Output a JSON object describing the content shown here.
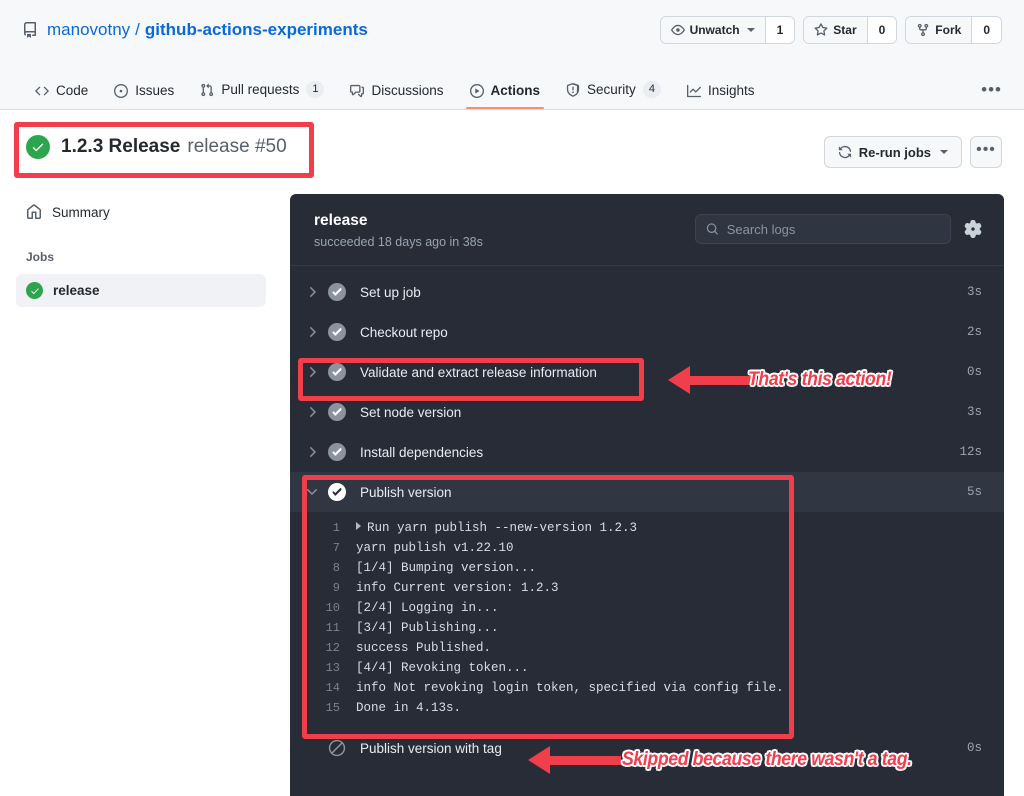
{
  "repo": {
    "owner": "manovotny",
    "separator": "/",
    "name": "github-actions-experiments",
    "repo_icon": "repo-icon"
  },
  "repo_actions": [
    {
      "label": "Unwatch",
      "count": "1",
      "icon": "eye-icon",
      "has_caret": true
    },
    {
      "label": "Star",
      "count": "0",
      "icon": "star-icon",
      "has_caret": false
    },
    {
      "label": "Fork",
      "count": "0",
      "icon": "fork-icon",
      "has_caret": false
    }
  ],
  "nav_tabs": [
    {
      "label": "Code",
      "icon": "code-icon",
      "badge": "",
      "active": false
    },
    {
      "label": "Issues",
      "icon": "issue-opened-icon",
      "badge": "",
      "active": false
    },
    {
      "label": "Pull requests",
      "icon": "git-pull-request-icon",
      "badge": "1",
      "active": false
    },
    {
      "label": "Discussions",
      "icon": "comment-discussion-icon",
      "badge": "",
      "active": false
    },
    {
      "label": "Actions",
      "icon": "play-icon",
      "badge": "",
      "active": true
    },
    {
      "label": "Security",
      "icon": "shield-icon",
      "badge": "4",
      "active": false
    },
    {
      "label": "Insights",
      "icon": "graph-icon",
      "badge": "",
      "active": false
    }
  ],
  "nav_overflow": "•••",
  "run": {
    "status_icon": "check-circle-fill-icon",
    "title": "1.2.3 Release",
    "subtitle": "release #50",
    "rerun_label": "Re-run jobs",
    "rerun_icon": "sync-icon",
    "overflow_label": "•••"
  },
  "sidebar": {
    "summary": {
      "label": "Summary",
      "icon": "home-icon"
    },
    "jobs_heading": "Jobs",
    "jobs": [
      {
        "label": "release",
        "status_icon": "check-circle-fill-icon",
        "selected": true
      }
    ]
  },
  "log_panel": {
    "job_name": "release",
    "job_status": "succeeded 18 days ago in 38s",
    "search": {
      "placeholder": "Search logs",
      "value": "",
      "icon": "search-icon"
    },
    "settings_icon": "gear-icon"
  },
  "steps": [
    {
      "label": "Set up job",
      "time": "3s",
      "status": "success",
      "expanded": false,
      "chevron": "chevron-right-icon"
    },
    {
      "label": "Checkout repo",
      "time": "2s",
      "status": "success",
      "expanded": false,
      "chevron": "chevron-right-icon"
    },
    {
      "label": "Validate and extract release information",
      "time": "0s",
      "status": "success",
      "expanded": false,
      "chevron": "chevron-right-icon"
    },
    {
      "label": "Set node version",
      "time": "3s",
      "status": "success",
      "expanded": false,
      "chevron": "chevron-right-icon"
    },
    {
      "label": "Install dependencies",
      "time": "12s",
      "status": "success",
      "expanded": false,
      "chevron": "chevron-right-icon"
    },
    {
      "label": "Publish version",
      "time": "5s",
      "status": "success",
      "expanded": true,
      "chevron": "chevron-down-icon"
    }
  ],
  "log_lines": [
    {
      "num": "1",
      "text": "Run yarn publish --new-version 1.2.3",
      "has_triangle": true
    },
    {
      "num": "7",
      "text": "yarn publish v1.22.10",
      "has_triangle": false
    },
    {
      "num": "8",
      "text": "[1/4] Bumping version...",
      "has_triangle": false
    },
    {
      "num": "9",
      "text": "info Current version: 1.2.3",
      "has_triangle": false
    },
    {
      "num": "10",
      "text": "[2/4] Logging in...",
      "has_triangle": false
    },
    {
      "num": "11",
      "text": "[3/4] Publishing...",
      "has_triangle": false
    },
    {
      "num": "12",
      "text": "success Published.",
      "has_triangle": false
    },
    {
      "num": "13",
      "text": "[4/4] Revoking token...",
      "has_triangle": false
    },
    {
      "num": "14",
      "text": "info Not revoking login token, specified via config file.",
      "has_triangle": false
    },
    {
      "num": "15",
      "text": "Done in 4.13s.",
      "has_triangle": false
    }
  ],
  "steps_after": [
    {
      "label": "Publish version with tag",
      "time": "0s",
      "status": "skipped",
      "chevron": "none"
    }
  ],
  "annotations": {
    "color": "#f03e4a",
    "action_note": "That's this action!",
    "skipped_note": "Skipped because there wasn't a tag."
  }
}
